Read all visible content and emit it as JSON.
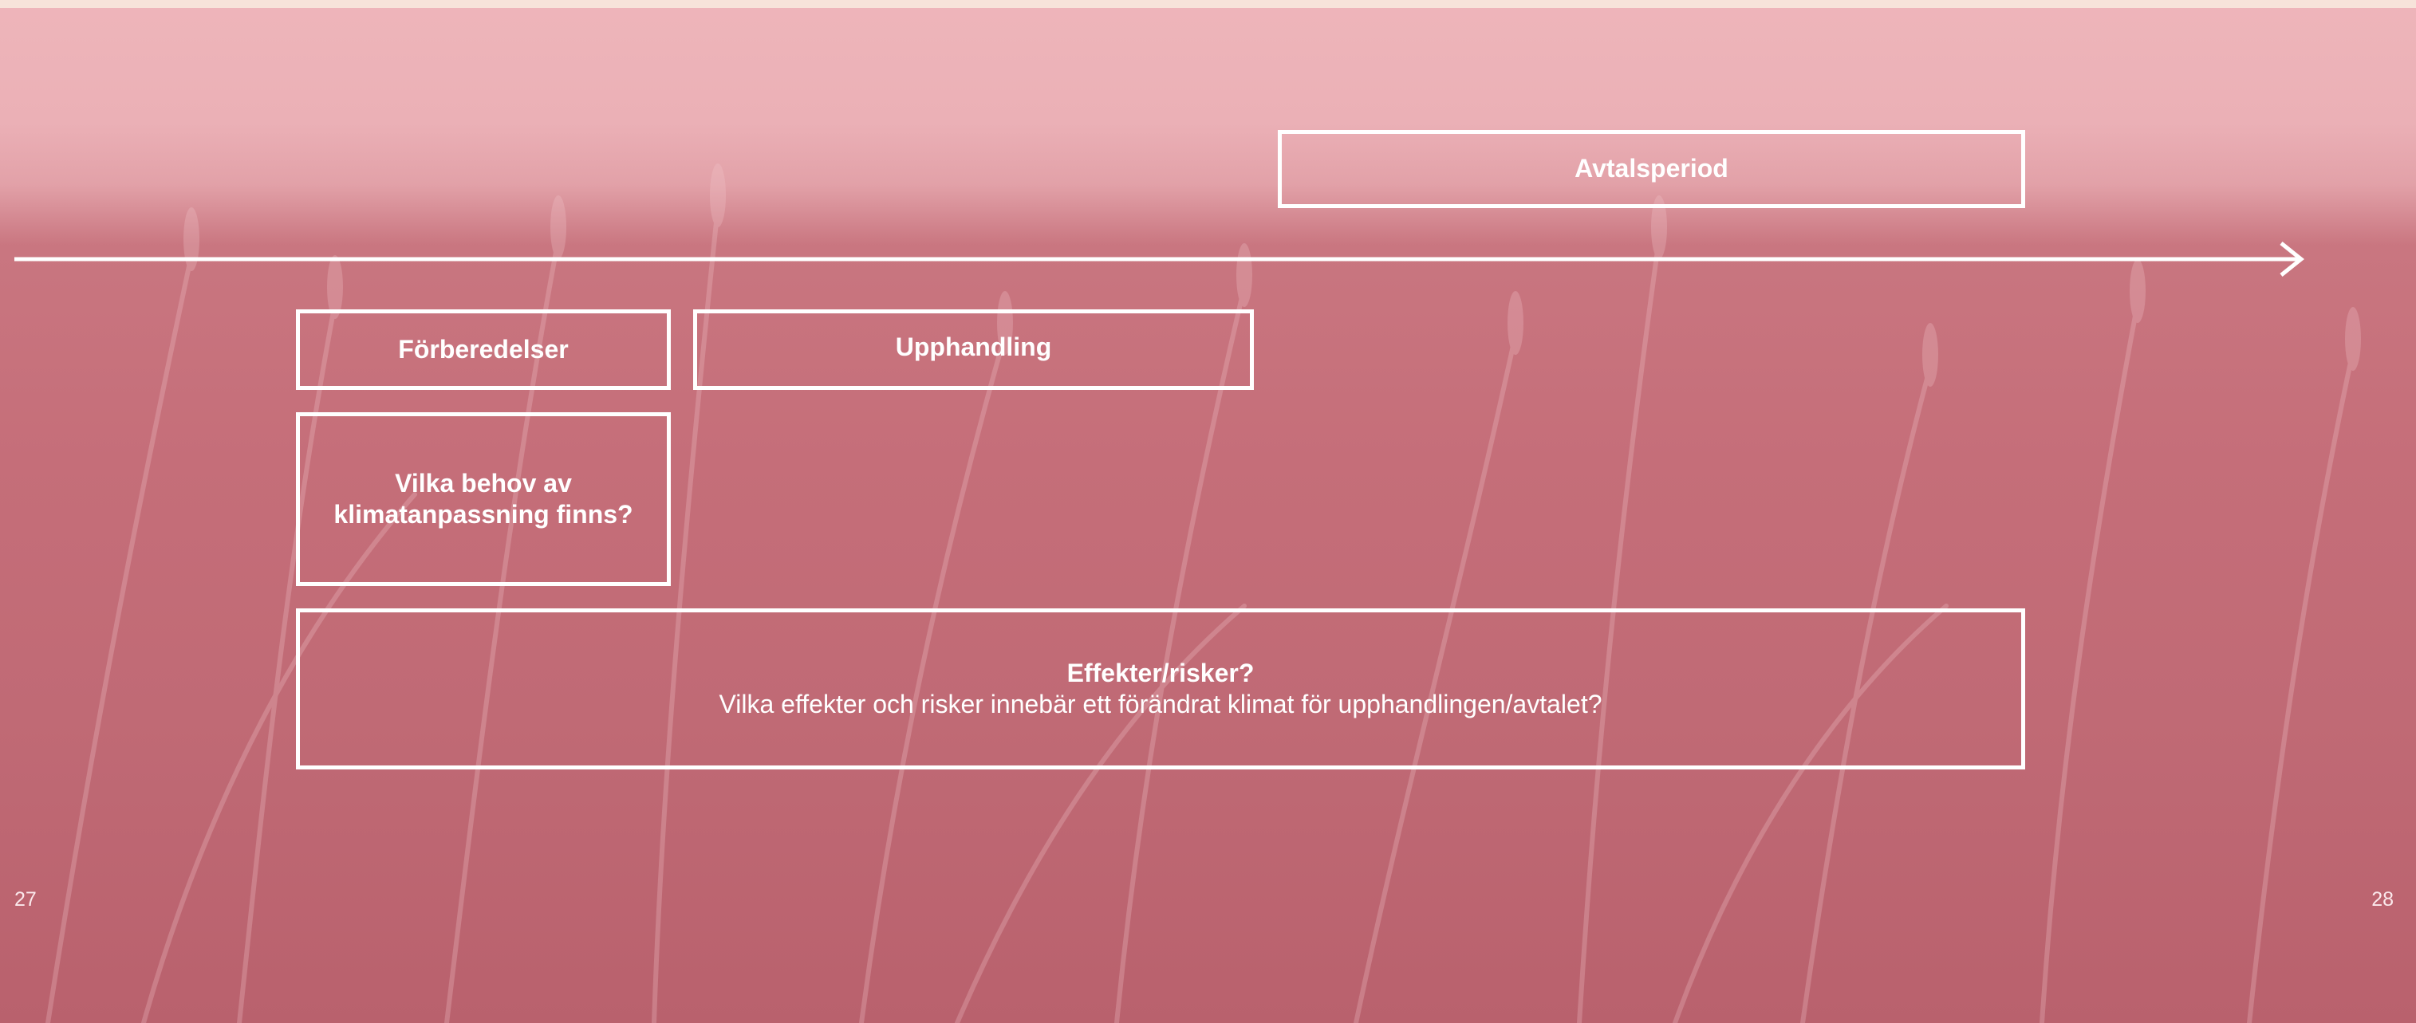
{
  "colors": {
    "overlay": "#c56e79",
    "sky": "#eeb5ba",
    "line": "#ffffff",
    "top_strip": "#f7e3da"
  },
  "timeline": {
    "arrow": "arrow-right-icon"
  },
  "boxes": {
    "avtalsperiod": {
      "label": "Avtalsperiod"
    },
    "forberedelser": {
      "label": "Förberedelser"
    },
    "upphandling": {
      "label": "Upphandling"
    },
    "behov": {
      "line1": "Vilka behov av",
      "line2": "klimatanpassning finns?"
    },
    "effekter": {
      "title": "Effekter/risker?",
      "text": "Vilka effekter och risker innebär ett förändrat klimat för upphandlingen/avtalet?"
    }
  },
  "pages": {
    "left": "27",
    "right": "28"
  }
}
